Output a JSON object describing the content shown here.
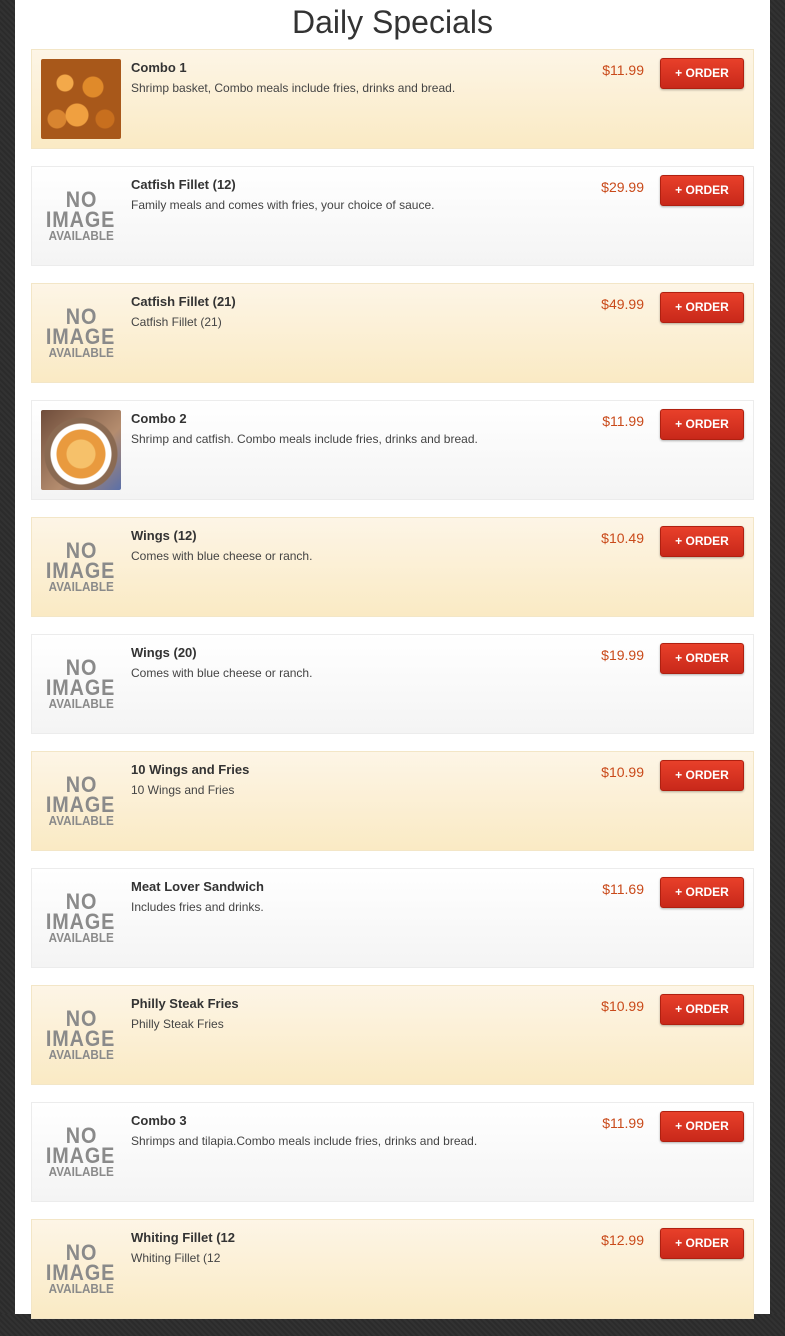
{
  "page": {
    "title": "Daily Specials"
  },
  "no_image": {
    "line1": "NO",
    "line2": "IMAGE",
    "line3": "AVAILABLE"
  },
  "items": [
    {
      "name": "Combo 1",
      "desc": "Shrimp basket, Combo meals include fries, drinks and bread.",
      "price": "$11.99",
      "button": "+ ORDER",
      "image": "photo-shrimp"
    },
    {
      "name": "Catfish Fillet (12)",
      "desc": "Family meals and comes with fries, your choice of sauce.",
      "price": "$29.99",
      "button": "+ ORDER",
      "image": "none"
    },
    {
      "name": "Catfish Fillet (21)",
      "desc": "Catfish Fillet (21)",
      "price": "$49.99",
      "button": "+ ORDER",
      "image": "none"
    },
    {
      "name": "Combo 2",
      "desc": "Shrimp and catfish. Combo meals include fries, drinks and bread.",
      "price": "$11.99",
      "button": "+ ORDER",
      "image": "photo-bowl"
    },
    {
      "name": "Wings (12)",
      "desc": "Comes with blue cheese or ranch.",
      "price": "$10.49",
      "button": "+ ORDER",
      "image": "none"
    },
    {
      "name": "Wings (20)",
      "desc": "Comes with blue cheese or ranch.",
      "price": "$19.99",
      "button": "+ ORDER",
      "image": "none"
    },
    {
      "name": "10 Wings and Fries",
      "desc": "10 Wings and Fries",
      "price": "$10.99",
      "button": "+ ORDER",
      "image": "none"
    },
    {
      "name": "Meat Lover Sandwich",
      "desc": "Includes fries and drinks.",
      "price": "$11.69",
      "button": "+ ORDER",
      "image": "none"
    },
    {
      "name": "Philly Steak Fries",
      "desc": "Philly Steak Fries",
      "price": "$10.99",
      "button": "+ ORDER",
      "image": "none"
    },
    {
      "name": "Combo 3",
      "desc": "Shrimps and tilapia.Combo meals include fries, drinks and bread.",
      "price": "$11.99",
      "button": "+ ORDER",
      "image": "none"
    },
    {
      "name": "Whiting Fillet (12",
      "desc": "Whiting Fillet (12",
      "price": "$12.99",
      "button": "+ ORDER",
      "image": "none"
    }
  ]
}
